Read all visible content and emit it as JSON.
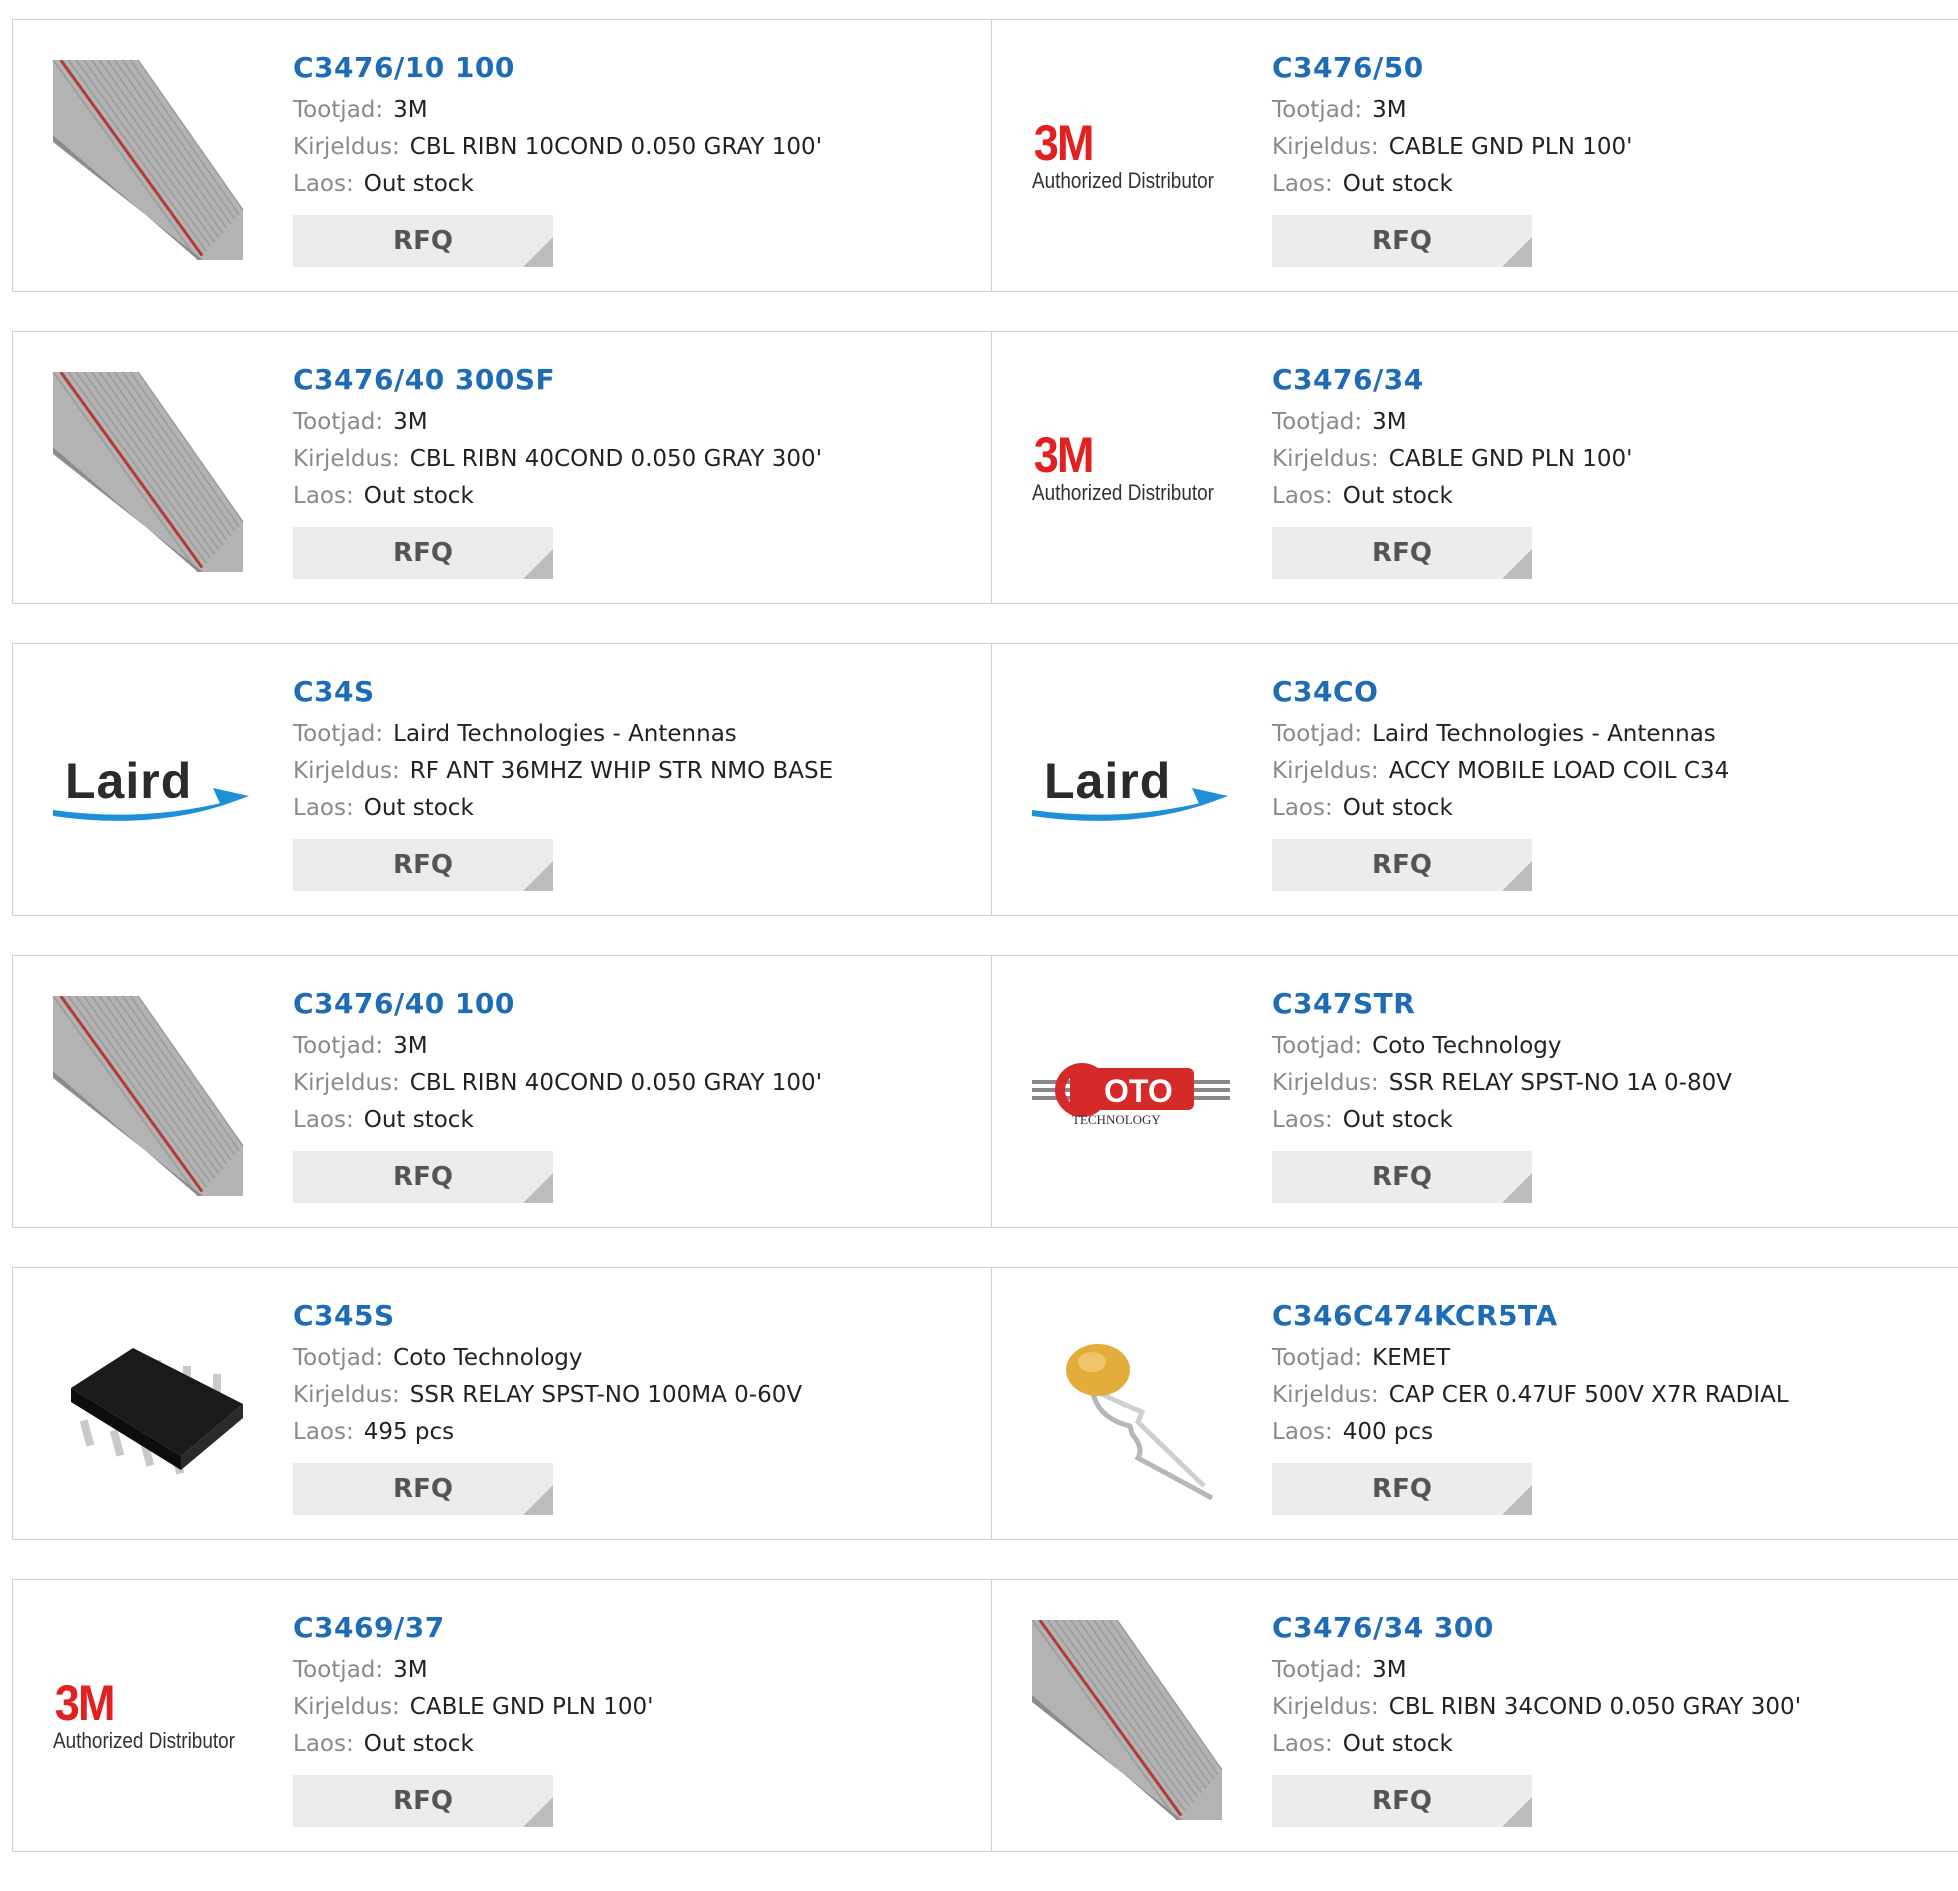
{
  "labels": {
    "manufacturer": "Tootjad:",
    "description": "Kirjeldus:",
    "stock": "Laos:",
    "rfq": "RFQ"
  },
  "logo_text": {
    "threem": "3M",
    "authorized": "Authorized Distributor",
    "laird": "Laird",
    "coto_main": "OTO",
    "coto_sub": "TECHNOLOGY"
  },
  "colors": {
    "link": "#1e6cb5",
    "rfq_bg": "#ececec",
    "border": "#cfcfcf"
  },
  "products": [
    {
      "part": "C3476/10 100",
      "manufacturer": "3M",
      "description": "CBL RIBN 10COND 0.050 GRAY 100'",
      "stock": "Out stock",
      "image": "ribbon-cable"
    },
    {
      "part": "C3476/50",
      "manufacturer": "3M",
      "description": "CABLE GND PLN 100'",
      "stock": "Out stock",
      "image": "3m-logo"
    },
    {
      "part": "C3476/40 300SF",
      "manufacturer": "3M",
      "description": "CBL RIBN 40COND 0.050 GRAY 300'",
      "stock": "Out stock",
      "image": "ribbon-cable"
    },
    {
      "part": "C3476/34",
      "manufacturer": "3M",
      "description": "CABLE GND PLN 100'",
      "stock": "Out stock",
      "image": "3m-logo"
    },
    {
      "part": "C34S",
      "manufacturer": "Laird Technologies - Antennas",
      "description": "RF ANT 36MHZ WHIP STR NMO BASE",
      "stock": "Out stock",
      "image": "laird-logo"
    },
    {
      "part": "C34CO",
      "manufacturer": "Laird Technologies - Antennas",
      "description": "ACCY MOBILE LOAD COIL C34",
      "stock": "Out stock",
      "image": "laird-logo"
    },
    {
      "part": "C3476/40 100",
      "manufacturer": "3M",
      "description": "CBL RIBN 40COND 0.050 GRAY 100'",
      "stock": "Out stock",
      "image": "ribbon-cable"
    },
    {
      "part": "C347STR",
      "manufacturer": "Coto Technology",
      "description": "SSR RELAY SPST-NO 1A 0-80V",
      "stock": "Out stock",
      "image": "coto-logo"
    },
    {
      "part": "C345S",
      "manufacturer": "Coto Technology",
      "description": "SSR RELAY SPST-NO 100MA 0-60V",
      "stock": "495 pcs",
      "image": "relay-chip"
    },
    {
      "part": "C346C474KCR5TA",
      "manufacturer": "KEMET",
      "description": "CAP CER 0.47UF 500V X7R RADIAL",
      "stock": "400 pcs",
      "image": "ceramic-capacitor"
    },
    {
      "part": "C3469/37",
      "manufacturer": "3M",
      "description": "CABLE GND PLN 100'",
      "stock": "Out stock",
      "image": "3m-logo"
    },
    {
      "part": "C3476/34 300",
      "manufacturer": "3M",
      "description": "CBL RIBN 34COND 0.050 GRAY 300'",
      "stock": "Out stock",
      "image": "ribbon-cable"
    }
  ]
}
